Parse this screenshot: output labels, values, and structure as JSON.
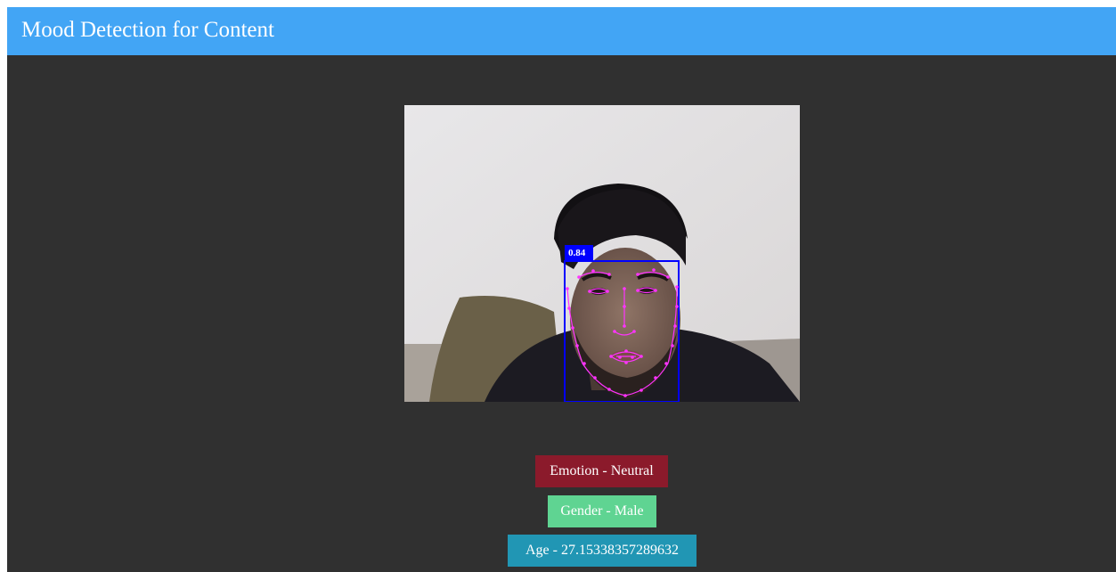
{
  "header": {
    "title": "Mood Detection for Content"
  },
  "video": {
    "detection_score": "0.84",
    "box_color": "#0000ff",
    "landmark_color": "#ff33ff"
  },
  "results": {
    "emotion": {
      "label": "Emotion - Neutral",
      "color": "#8b1a2b"
    },
    "gender": {
      "label": "Gender - Male",
      "color": "#5fd492"
    },
    "age": {
      "label": "Age - 27.15338357289632",
      "color": "#2196b4"
    }
  },
  "colors": {
    "header_bg": "#42a5f5",
    "page_bg": "#303030"
  }
}
